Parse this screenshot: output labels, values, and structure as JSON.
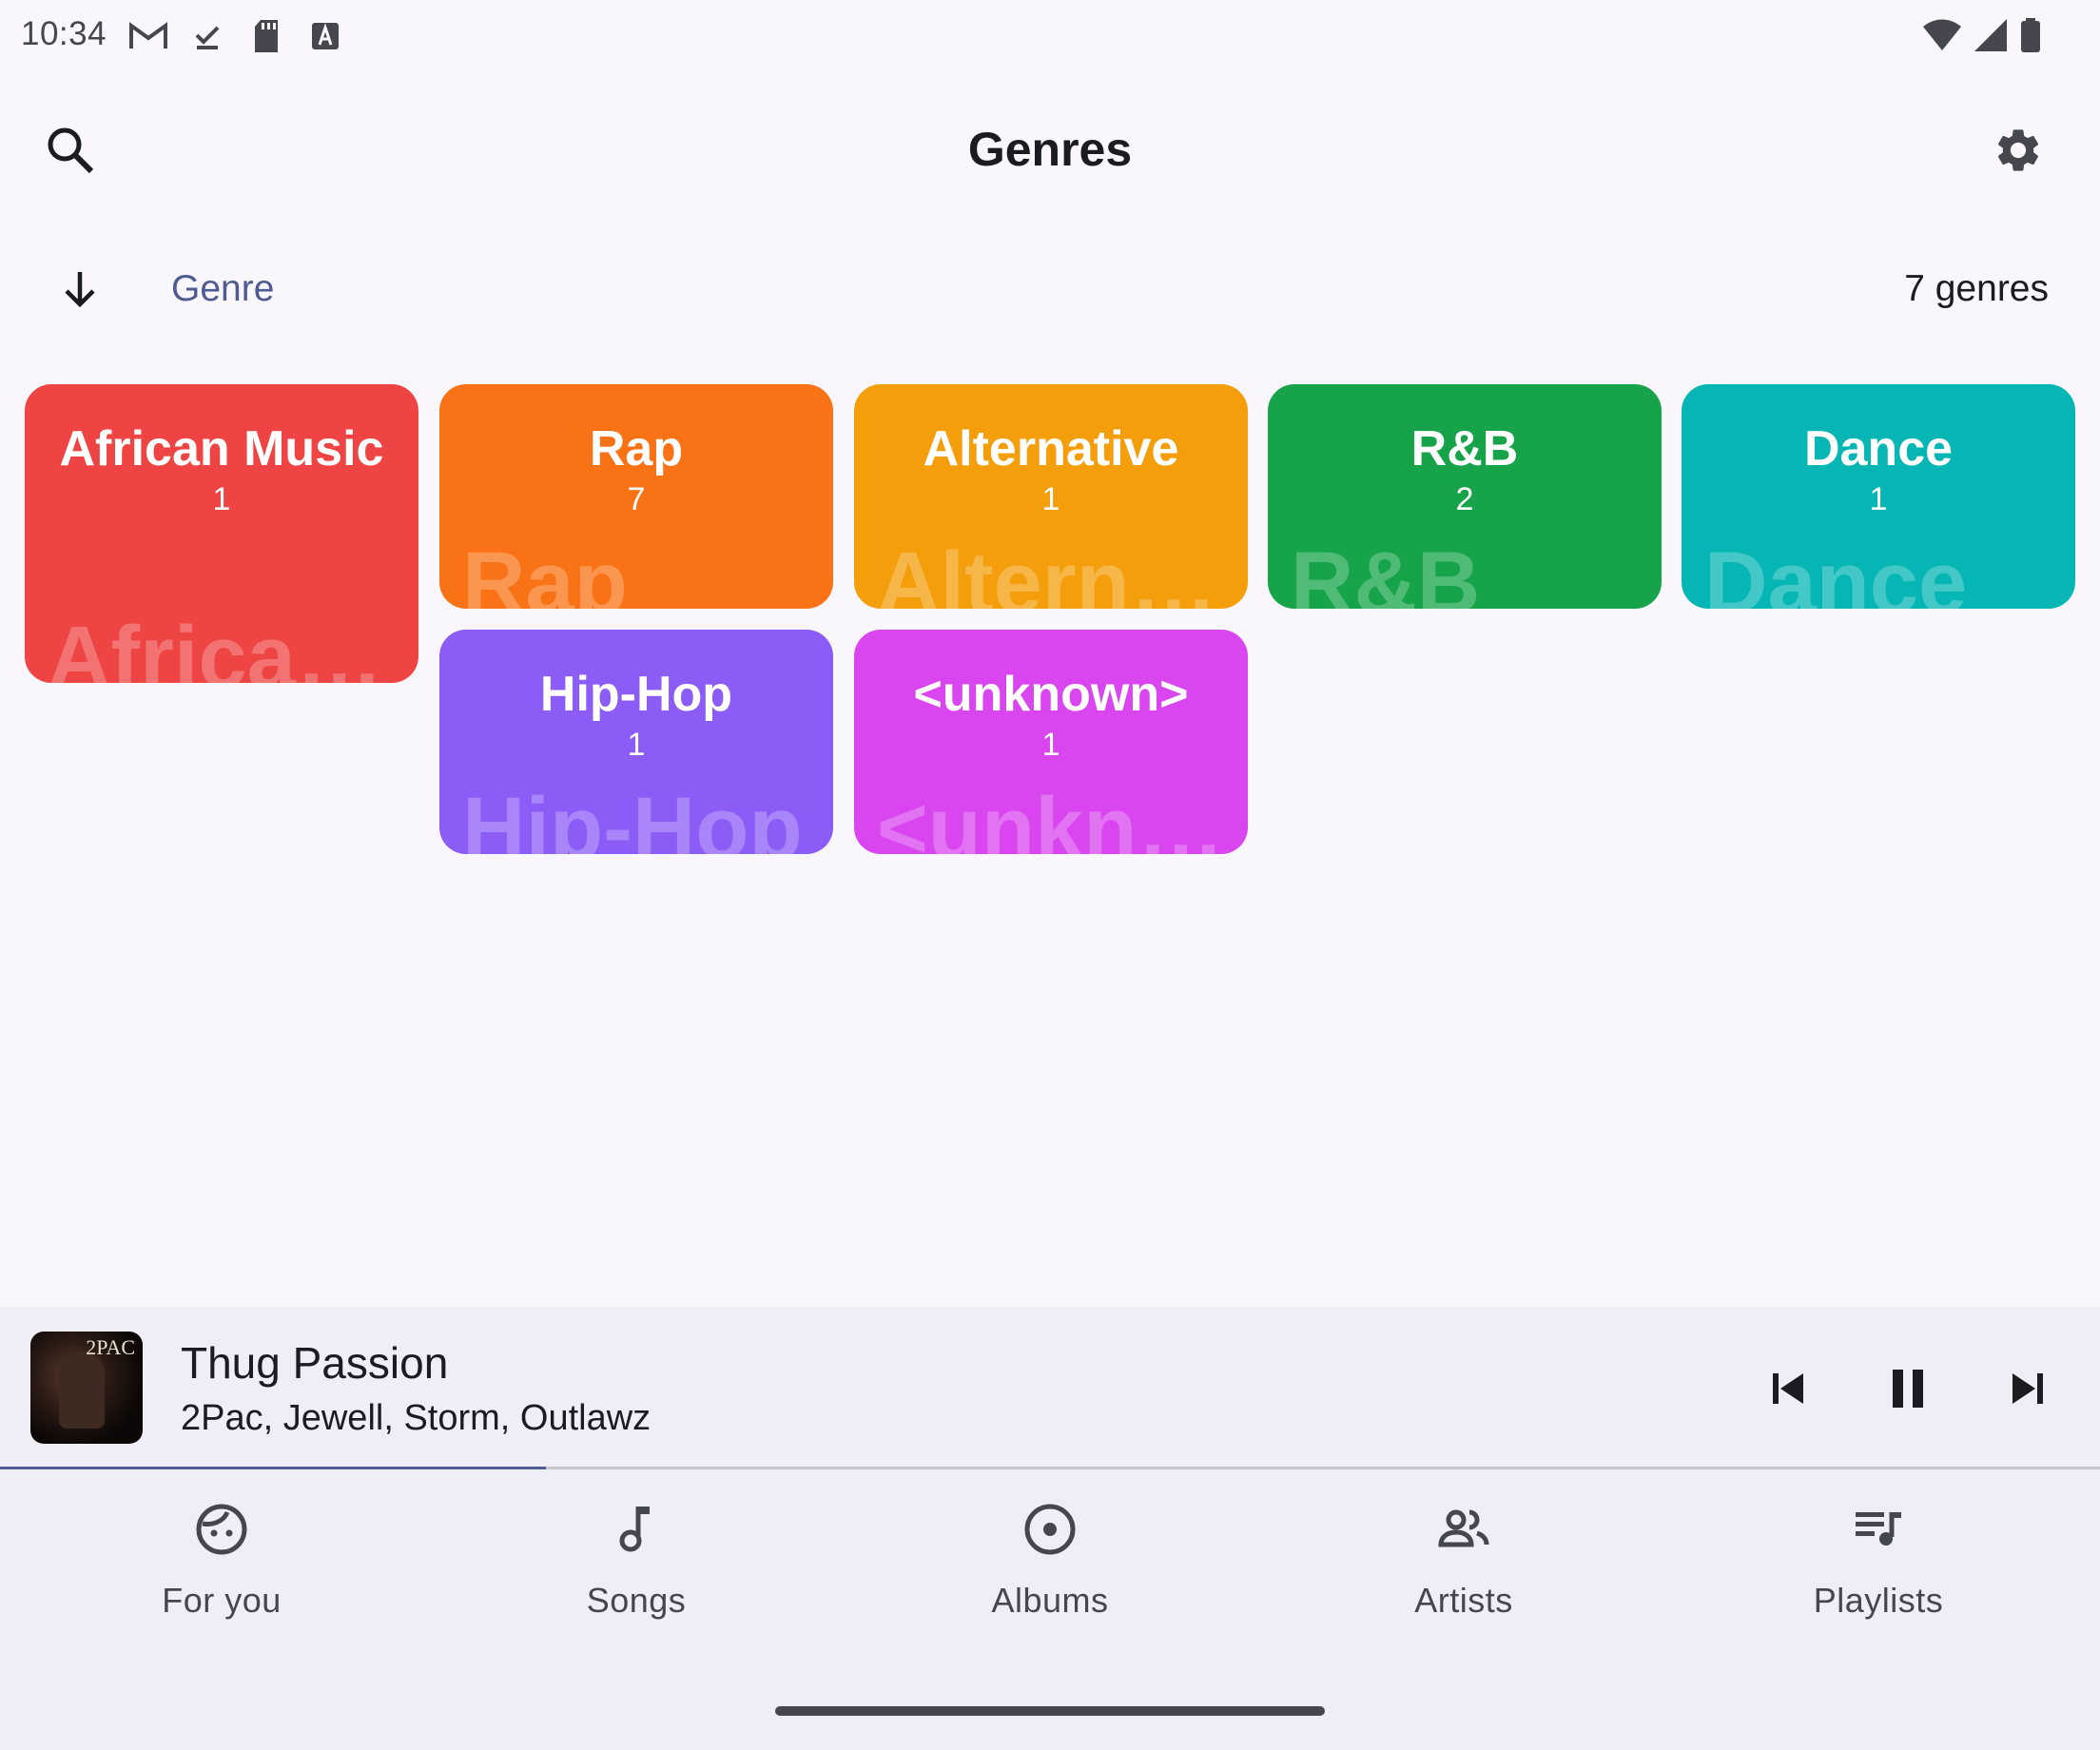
{
  "status_bar": {
    "time": "10:34",
    "left_icons": [
      "gmail-icon",
      "download-done-icon",
      "sd-card-icon",
      "accessibility-a-icon"
    ],
    "right_icons": [
      "wifi-icon",
      "cell-signal-icon",
      "battery-icon"
    ]
  },
  "header": {
    "title": "Genres",
    "search_icon": "search-icon",
    "settings_icon": "gear-icon"
  },
  "sort": {
    "direction_icon": "arrow-down-icon",
    "label": "Genre",
    "count_text": "7 genres"
  },
  "genres": [
    {
      "name": "African Music",
      "count": "1",
      "ghost": "African ...",
      "color": "#ef4444"
    },
    {
      "name": "Rap",
      "count": "7",
      "ghost": "Rap",
      "color": "#f97316"
    },
    {
      "name": "Alternative",
      "count": "1",
      "ghost": "Alterna...",
      "color": "#f59e0b"
    },
    {
      "name": "R&B",
      "count": "2",
      "ghost": "R&B",
      "color": "#16a34a"
    },
    {
      "name": "Dance",
      "count": "1",
      "ghost": "Dance",
      "color": "#06b6b4"
    },
    {
      "name": "Hip-Hop",
      "count": "1",
      "ghost": "Hip-Hop",
      "color": "#8b5cf6"
    },
    {
      "name": "<unknown>",
      "count": "1",
      "ghost": "<unkno...",
      "color": "#d946ef"
    }
  ],
  "mini_player": {
    "title": "Thug Passion",
    "artist": "2Pac, Jewell, Storm, Outlawz",
    "album_art_text": "2PAC",
    "progress": 0.26,
    "controls": [
      "skip-previous-icon",
      "pause-icon",
      "skip-next-icon"
    ]
  },
  "nav": {
    "items": [
      {
        "label": "For you",
        "icon": "face-icon"
      },
      {
        "label": "Songs",
        "icon": "music-note-icon"
      },
      {
        "label": "Albums",
        "icon": "album-icon"
      },
      {
        "label": "Artists",
        "icon": "people-icon"
      },
      {
        "label": "Playlists",
        "icon": "playlist-icon"
      }
    ]
  },
  "colors": {
    "accent": "#4f5b92",
    "background": "#f9f7fc",
    "surface": "#efeef7"
  }
}
